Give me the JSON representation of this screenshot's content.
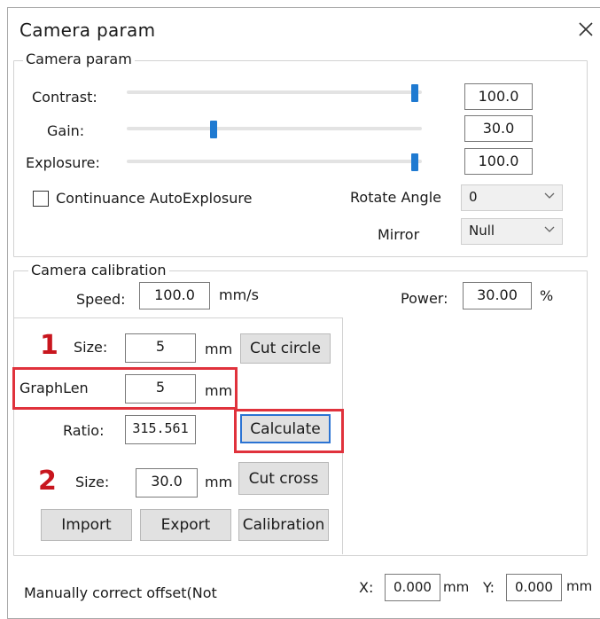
{
  "window": {
    "title": "Camera param",
    "close_glyph": "✕"
  },
  "camera_param": {
    "legend": "Camera param",
    "contrast": {
      "label": "Contrast:",
      "value": "100.0",
      "level": 1.0
    },
    "gain": {
      "label": "Gain:",
      "value": "30.0",
      "level": 0.3
    },
    "exposure": {
      "label": "Explosure:",
      "value": "100.0",
      "level": 1.0
    },
    "auto_exposure": {
      "label": "Continuance AutoExplosure",
      "checked": false
    },
    "rotate_angle": {
      "label": "Rotate Angle",
      "value": "0"
    },
    "mirror": {
      "label": "Mirror",
      "value": "Null"
    }
  },
  "calibration": {
    "legend": "Camera calibration",
    "speed_label": "Speed:",
    "speed_value": "100.0",
    "speed_unit": "mm/s",
    "power_label": "Power:",
    "power_value": "30.00",
    "power_unit": "%",
    "marker1": "1",
    "marker2": "2",
    "circle_size_label": "Size:",
    "circle_size_value": "5",
    "circle_size_unit": "mm",
    "cut_circle_label": "Cut circle",
    "graphlen_label": "GraphLen",
    "graphlen_value": "5",
    "graphlen_unit": "mm",
    "ratio_label": "Ratio:",
    "ratio_value": "315.561",
    "calculate_label": "Calculate",
    "cross_size_label": "Size:",
    "cross_size_value": "30.0",
    "cross_size_unit": "mm",
    "cut_cross_label": "Cut cross",
    "import_label": "Import",
    "export_label": "Export",
    "calibration_label": "Calibration"
  },
  "offset": {
    "label": "Manually correct offset(Not",
    "x_label": "X:",
    "x_value": "0.000",
    "x_unit": "mm",
    "y_label": "Y:",
    "y_value": "0.000",
    "y_unit": "mm"
  },
  "colors": {
    "accent": "#1f7ad1",
    "highlight_red": "#e0323c",
    "marker_red": "#c8161e"
  }
}
